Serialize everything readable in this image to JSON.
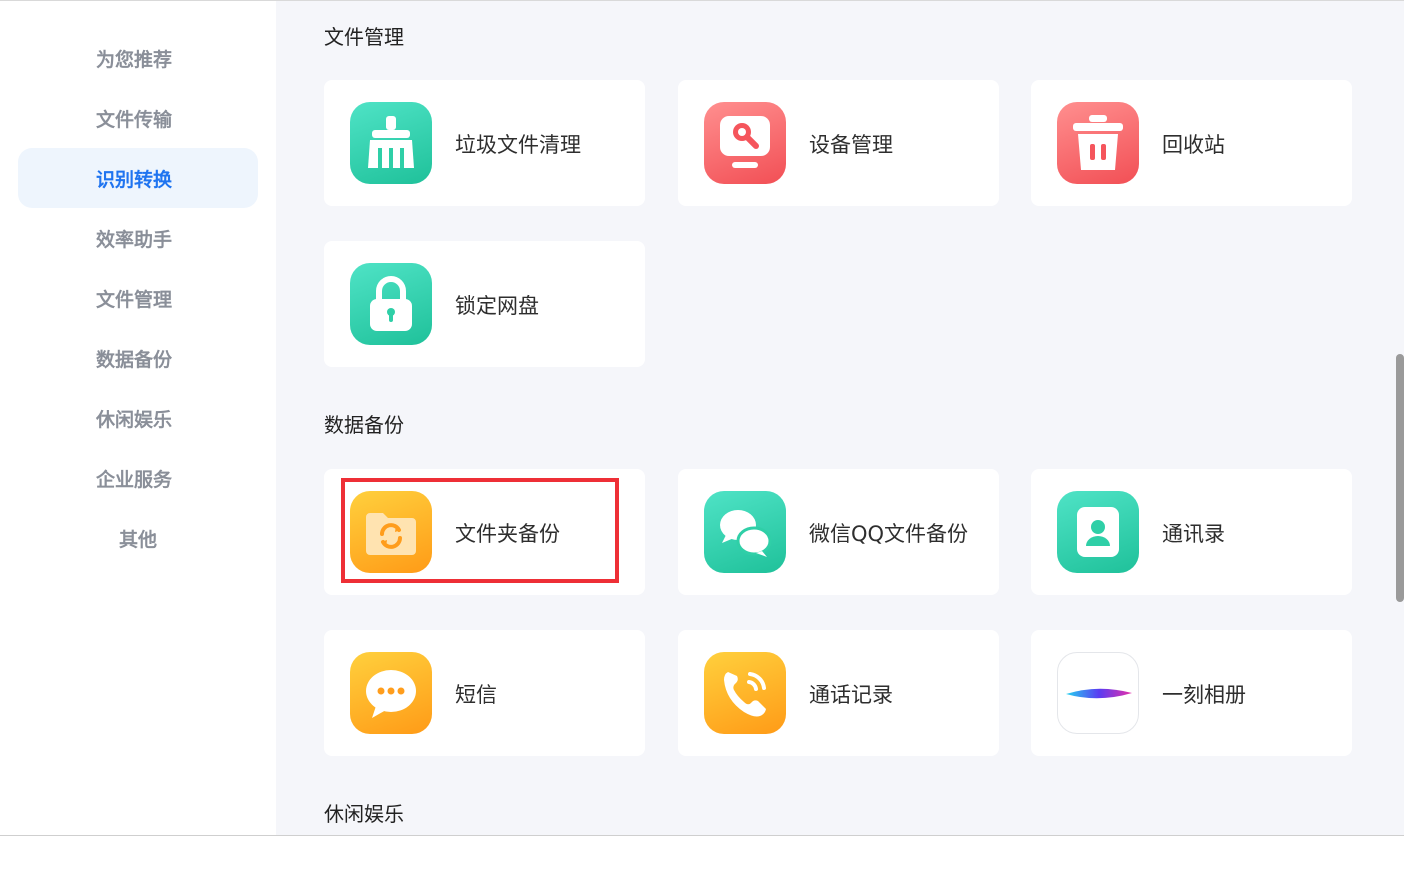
{
  "sidebar": {
    "items": [
      {
        "label": "为您推荐"
      },
      {
        "label": "文件传输"
      },
      {
        "label": "识别转换"
      },
      {
        "label": "效率助手"
      },
      {
        "label": "文件管理"
      },
      {
        "label": "数据备份"
      },
      {
        "label": "休闲娱乐"
      },
      {
        "label": "企业服务"
      },
      {
        "label": "其他"
      }
    ],
    "active_label": "识别转换"
  },
  "sections": [
    {
      "title": "文件管理",
      "cards": [
        {
          "label": "垃圾文件清理",
          "icon": "broom-icon",
          "color": "#26c9a3"
        },
        {
          "label": "设备管理",
          "icon": "device-monitor-icon",
          "color": "#f35b62"
        },
        {
          "label": "回收站",
          "icon": "trash-bin-icon",
          "color": "#f35b62"
        },
        {
          "label": "锁定网盘",
          "icon": "lock-icon",
          "color": "#26c9a3"
        }
      ]
    },
    {
      "title": "数据备份",
      "cards": [
        {
          "label": "文件夹备份",
          "icon": "folder-sync-icon",
          "color": "#ffa51f"
        },
        {
          "label": "微信QQ文件备份",
          "icon": "chat-bubbles-icon",
          "color": "#26c9a3"
        },
        {
          "label": "通讯录",
          "icon": "contacts-icon",
          "color": "#26c9a3"
        },
        {
          "label": "短信",
          "icon": "sms-bubble-icon",
          "color": "#ffa51f"
        },
        {
          "label": "通话记录",
          "icon": "phone-call-icon",
          "color": "#ffa51f"
        },
        {
          "label": "一刻相册",
          "icon": "album-feather-icon",
          "color": "#ffffff"
        }
      ]
    },
    {
      "title": "休闲娱乐",
      "cards": []
    }
  ],
  "highlight_color": "#ee2f36",
  "accent_color": "#1f74f0"
}
